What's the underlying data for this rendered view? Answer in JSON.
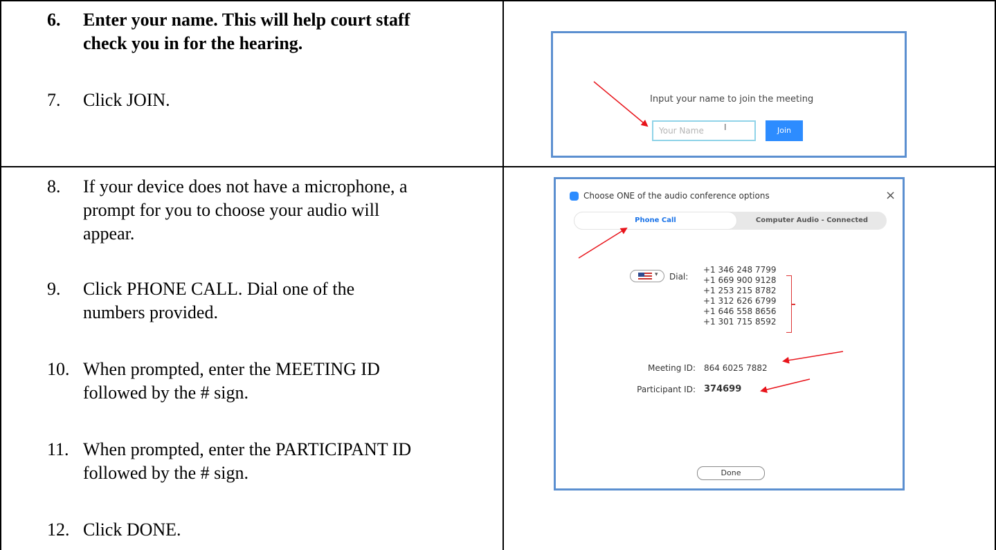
{
  "instructions": {
    "step6_num": "6.",
    "step6_line1": "Enter your name.  This will help court staff",
    "step6_line2": "check you in for the hearing.",
    "step7_num": "7.",
    "step7_text": "Click JOIN.",
    "step8_num": "8.",
    "step8_line1": "If your device does not have a microphone, a",
    "step8_line2": "prompt for you to choose your audio will",
    "step8_line3": "appear.",
    "step9_num": "9.",
    "step9_line1": "Click PHONE CALL. Dial one of the",
    "step9_line2": "numbers provided.",
    "step10_num": "10.",
    "step10_line1": "When prompted, enter the MEETING ID",
    "step10_line2": "followed by the # sign.",
    "step11_num": "11.",
    "step11_line1": "When prompted, enter the PARTICIPANT ID",
    "step11_line2": "followed by the # sign.",
    "step12_num": "12.",
    "step12_text": "Click DONE."
  },
  "join_screen": {
    "prompt": "Input your name to join the meeting",
    "name_placeholder": "Your Name",
    "join_label": "Join"
  },
  "audio_dialog": {
    "title": "Choose ONE of the audio conference options",
    "close_glyph": "×",
    "tab_phone": "Phone Call",
    "tab_computer": "Computer Audio - Connected",
    "dial_label": "Dial:",
    "dial_numbers": [
      "+1 346 248 7799",
      "+1 669 900 9128",
      "+1 253 215 8782",
      "+1 312 626 6799",
      "+1 646 558 8656",
      "+1 301 715 8592"
    ],
    "meeting_id_label": "Meeting ID:",
    "meeting_id": "864 6025 7882",
    "participant_id_label": "Participant ID:",
    "participant_id": "374699",
    "done_label": "Done"
  },
  "colors": {
    "annotation_red": "#e8141b",
    "frame_blue": "#5b8fd0",
    "zoom_blue": "#2d8cff"
  }
}
